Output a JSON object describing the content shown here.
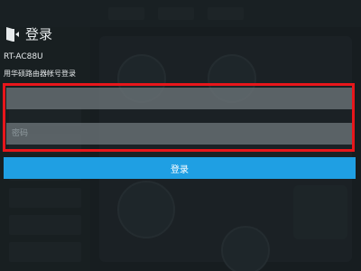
{
  "login": {
    "title": "登录",
    "device_model": "RT-AC88U",
    "hint": "用华硕路由器帐号登录",
    "username": {
      "value": "",
      "placeholder": ""
    },
    "password": {
      "value": "",
      "placeholder": "密码"
    },
    "submit_label": "登录"
  },
  "icons": {
    "login": "login-door-icon"
  },
  "colors": {
    "accent": "#1f9fe3",
    "highlight": "#e8161b",
    "text": "#e6eaec"
  }
}
